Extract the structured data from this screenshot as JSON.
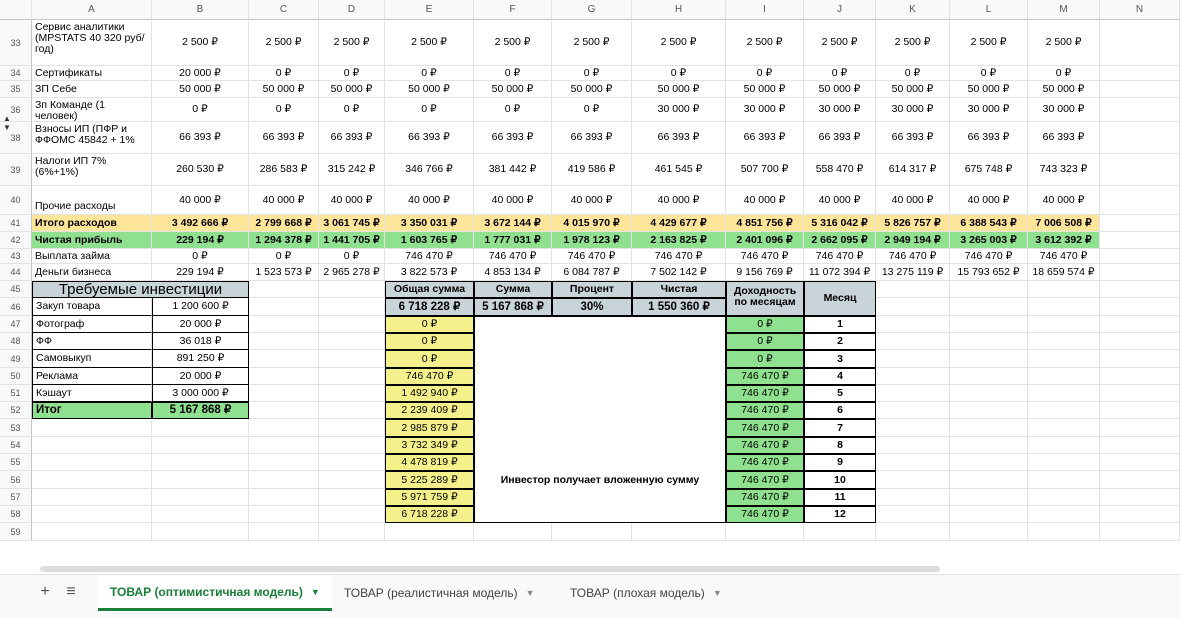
{
  "columns": [
    "A",
    "B",
    "C",
    "D",
    "E",
    "F",
    "G",
    "H",
    "I",
    "J",
    "K",
    "L",
    "M",
    "N"
  ],
  "rows": [
    {
      "num": "33",
      "a": "Сервис аналитики (MPSTATS 40 320 руб/год)",
      "vals": [
        "2 500 ₽",
        "2 500 ₽",
        "2 500 ₽",
        "2 500 ₽",
        "2 500 ₽",
        "2 500 ₽",
        "2 500 ₽",
        "2 500 ₽",
        "2 500 ₽",
        "2 500 ₽",
        "2 500 ₽",
        "2 500 ₽"
      ]
    },
    {
      "num": "34",
      "a": "Сертификаты",
      "vals": [
        "20 000 ₽",
        "0 ₽",
        "0 ₽",
        "0 ₽",
        "0 ₽",
        "0 ₽",
        "0 ₽",
        "0 ₽",
        "0 ₽",
        "0 ₽",
        "0 ₽",
        "0 ₽"
      ]
    },
    {
      "num": "35",
      "a": "ЗП Себе",
      "vals": [
        "50 000 ₽",
        "50 000 ₽",
        "50 000 ₽",
        "50 000 ₽",
        "50 000 ₽",
        "50 000 ₽",
        "50 000 ₽",
        "50 000 ₽",
        "50 000 ₽",
        "50 000 ₽",
        "50 000 ₽",
        "50 000 ₽"
      ]
    },
    {
      "num": "36",
      "a": "Зп Команде (1 человек)",
      "vals": [
        "0 ₽",
        "0 ₽",
        "0 ₽",
        "0 ₽",
        "0 ₽",
        "0 ₽",
        "30 000 ₽",
        "30 000 ₽",
        "30 000 ₽",
        "30 000 ₽",
        "30 000 ₽",
        "30 000 ₽"
      ]
    },
    {
      "num": "38",
      "a": "Взносы ИП (ПФР и ФФОМС 45842 + 1%",
      "vals": [
        "66 393 ₽",
        "66 393 ₽",
        "66 393 ₽",
        "66 393 ₽",
        "66 393 ₽",
        "66 393 ₽",
        "66 393 ₽",
        "66 393 ₽",
        "66 393 ₽",
        "66 393 ₽",
        "66 393 ₽",
        "66 393 ₽"
      ]
    },
    {
      "num": "39",
      "a": "Налоги ИП 7% (6%+1%)",
      "vals": [
        "260 530 ₽",
        "286 583 ₽",
        "315 242 ₽",
        "346 766 ₽",
        "381 442 ₽",
        "419 586 ₽",
        "461 545 ₽",
        "507 700 ₽",
        "558 470 ₽",
        "614 317 ₽",
        "675 748 ₽",
        "743 323 ₽"
      ]
    },
    {
      "num": "40",
      "a": "Прочие расходы",
      "vals": [
        "40 000 ₽",
        "40 000 ₽",
        "40 000 ₽",
        "40 000 ₽",
        "40 000 ₽",
        "40 000 ₽",
        "40 000 ₽",
        "40 000 ₽",
        "40 000 ₽",
        "40 000 ₽",
        "40 000 ₽",
        "40 000 ₽"
      ]
    },
    {
      "num": "41",
      "a": "Итого расходов",
      "vals": [
        "3 492 666 ₽",
        "2 799 668 ₽",
        "3 061 745 ₽",
        "3 350 031 ₽",
        "3 672 144 ₽",
        "4 015 970 ₽",
        "4 429 677 ₽",
        "4 851 756 ₽",
        "5 316 042 ₽",
        "5 826 757 ₽",
        "6 388 543 ₽",
        "7 006 508 ₽"
      ]
    },
    {
      "num": "42",
      "a": "Чистая прибыль",
      "vals": [
        "229 194 ₽",
        "1 294 378 ₽",
        "1 441 705 ₽",
        "1 603 765 ₽",
        "1 777 031 ₽",
        "1 978 123 ₽",
        "2 163 825 ₽",
        "2 401 096 ₽",
        "2 662 095 ₽",
        "2 949 194 ₽",
        "3 265 003 ₽",
        "3 612 392 ₽"
      ]
    },
    {
      "num": "43",
      "a": "Выплата займа",
      "vals": [
        "0 ₽",
        "0 ₽",
        "0 ₽",
        "746 470 ₽",
        "746 470 ₽",
        "746 470 ₽",
        "746 470 ₽",
        "746 470 ₽",
        "746 470 ₽",
        "746 470 ₽",
        "746 470 ₽",
        "746 470 ₽"
      ]
    },
    {
      "num": "44",
      "a": "Деньги бизнеса",
      "vals": [
        "229 194 ₽",
        "1 523 573 ₽",
        "2 965 278 ₽",
        "3 822 573 ₽",
        "4 853 134 ₽",
        "6 084 787 ₽",
        "7 502 142 ₽",
        "9 156 769 ₽",
        "11 072 394 ₽",
        "13 275 119 ₽",
        "15 793 652 ₽",
        "18 659 574 ₽"
      ]
    }
  ],
  "lower_row_numbers": [
    "45",
    "46",
    "47",
    "48",
    "49",
    "50",
    "51",
    "52",
    "53",
    "54",
    "55",
    "56",
    "57",
    "58",
    "59"
  ],
  "investments": {
    "title": "Требуемые инвестиции",
    "items": [
      {
        "label": "Закуп товара",
        "value": "1 200 600 ₽"
      },
      {
        "label": "Фотограф",
        "value": "20 000 ₽"
      },
      {
        "label": "ФФ",
        "value": "36 018 ₽"
      },
      {
        "label": "Самовыкуп",
        "value": "891 250 ₽"
      },
      {
        "label": "Реклама",
        "value": "20 000 ₽"
      },
      {
        "label": "Кэшаут",
        "value": "3 000 000 ₽"
      }
    ],
    "total_label": "Итог",
    "total_value": "5 167 868 ₽"
  },
  "summary": {
    "headers": [
      "Общая сумма",
      "Сумма",
      "Процент",
      "Чистая"
    ],
    "values": [
      "6 718 228 ₽",
      "5 167 868 ₽",
      "30%",
      "1 550 360 ₽"
    ]
  },
  "cumulative": [
    "0 ₽",
    "0 ₽",
    "0 ₽",
    "746 470 ₽",
    "1 492 940 ₽",
    "2 239 409 ₽",
    "2 985 879 ₽",
    "3 732 349 ₽",
    "4 478 819 ₽",
    "5 225 289 ₽",
    "5 971 759 ₽",
    "6 718 228 ₽"
  ],
  "investor_note": "Инвестор получает вложенную сумму",
  "monthly": {
    "header_income": "Доходность по месяцам",
    "header_month": "Месяц",
    "income": [
      "0 ₽",
      "0 ₽",
      "0 ₽",
      "746 470 ₽",
      "746 470 ₽",
      "746 470 ₽",
      "746 470 ₽",
      "746 470 ₽",
      "746 470 ₽",
      "746 470 ₽",
      "746 470 ₽",
      "746 470 ₽"
    ],
    "months": [
      "1",
      "2",
      "3",
      "4",
      "5",
      "6",
      "7",
      "8",
      "9",
      "10",
      "11",
      "12"
    ]
  },
  "tabs": [
    {
      "label": "ТОВАР (оптимистичная модель)",
      "active": true
    },
    {
      "label": "ТОВАР (реалистичная модель)",
      "active": false
    },
    {
      "label": "ТОВАР (плохая модель)",
      "active": false
    }
  ],
  "icons": {
    "add": "plus-icon",
    "list": "menu-icon",
    "dropdown": "chevron-down-icon"
  },
  "colors": {
    "yellow": "#ffe599",
    "light_yellow": "#f4f18d",
    "green": "#8fe08f",
    "gray": "#c9d4d9",
    "tab_active": "#188038"
  }
}
